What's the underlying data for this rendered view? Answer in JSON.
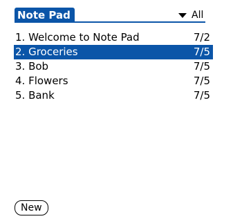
{
  "app": {
    "title": "Note Pad"
  },
  "category": {
    "selected": "All",
    "icon": "dropdown-triangle-icon"
  },
  "notes": [
    {
      "title": "1. Welcome to Note Pad",
      "date": "7/2",
      "selected": false
    },
    {
      "title": "2. Groceries",
      "date": "7/5",
      "selected": true
    },
    {
      "title": "3. Bob",
      "date": "7/5",
      "selected": false
    },
    {
      "title": "4. Flowers",
      "date": "7/5",
      "selected": false
    },
    {
      "title": "5. Bank",
      "date": "7/5",
      "selected": false
    }
  ],
  "actions": {
    "new_label": "New"
  },
  "colors": {
    "accent": "#0b55a8",
    "background": "#ffffff",
    "text": "#000000",
    "selected_text": "#ffffff"
  }
}
